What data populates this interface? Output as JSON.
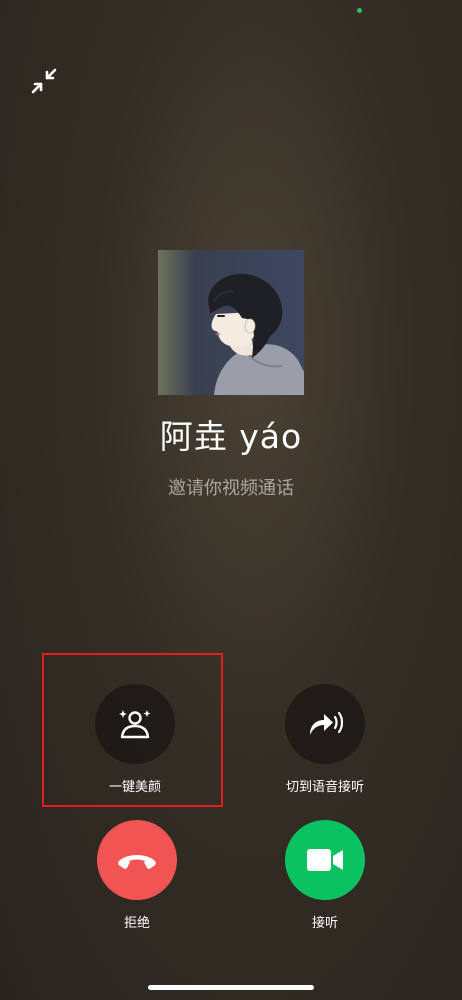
{
  "caller": {
    "name": "阿垚 yáo",
    "status": "邀请你视频通话"
  },
  "controls": {
    "beauty_label": "一键美颜",
    "switch_voice_label": "切到语音接听",
    "decline_label": "拒绝",
    "answer_label": "接听"
  },
  "colors": {
    "decline": "#f25454",
    "answer": "#0ac25f",
    "highlight": "#e02020"
  },
  "icons": {
    "minimize": "minimize-arrows-icon",
    "beauty": "person-sparkle-icon",
    "switch_voice": "voice-switch-icon",
    "decline": "hang-up-phone-icon",
    "answer": "video-camera-icon"
  }
}
